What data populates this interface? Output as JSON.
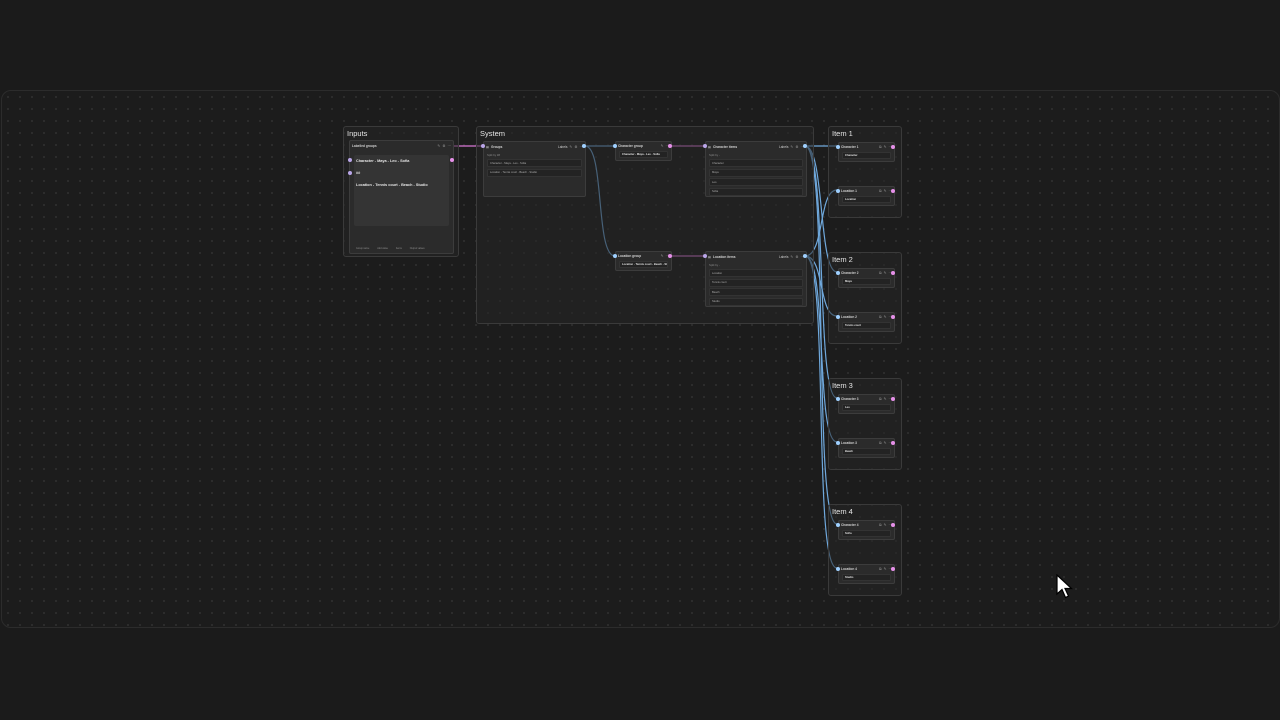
{
  "groups": {
    "inputs": "Inputs",
    "system": "System",
    "item1": "Item 1",
    "item2": "Item 2",
    "item3": "Item 3",
    "item4": "Item 4"
  },
  "inputs_node": {
    "header": "Labelled groups",
    "line1": "Character - Maya - Leo - Sofia",
    "marker": "##",
    "line2": "Location - Tennis court - Beach - Studio",
    "footer": [
      "Group name",
      "Add value",
      "Items",
      "Output values"
    ]
  },
  "splitter": {
    "title": "Groups",
    "badge": "Labels",
    "tag": "Split by ##",
    "rows": [
      "Character - Maya - Leo - Sofia",
      "Location - Tennis court - Beach - Studio"
    ]
  },
  "char_group": {
    "title": "Character group",
    "value": "Character - Maya - Leo - Sofia"
  },
  "loc_group": {
    "title": "Location group",
    "value": "Location - Tennis court - Beach - Studio"
  },
  "char_items": {
    "title": "Character items",
    "badge": "Labels",
    "tag": "Split by -",
    "rows": [
      "Character",
      "Maya",
      "Leo",
      "Sofia"
    ]
  },
  "loc_items": {
    "title": "Location items",
    "badge": "Labels",
    "tag": "Split by -",
    "rows": [
      "Location",
      "Tennis court",
      "Beach",
      "Studio"
    ]
  },
  "items": [
    {
      "char_title": "Character 1",
      "char_value": "Character",
      "loc_title": "Location 1",
      "loc_value": "Location"
    },
    {
      "char_title": "Character 2",
      "char_value": "Maya",
      "loc_title": "Location 2",
      "loc_value": "Tennis court"
    },
    {
      "char_title": "Character 3",
      "char_value": "Leo",
      "loc_title": "Location 3",
      "loc_value": "Beach"
    },
    {
      "char_title": "Character 4",
      "char_value": "Sofia",
      "loc_title": "Location 4",
      "loc_value": "Studio"
    }
  ],
  "colors": {
    "wire_blue": "#6fa8dc",
    "wire_pink": "#d977d6",
    "background": "#1b1b1b"
  }
}
